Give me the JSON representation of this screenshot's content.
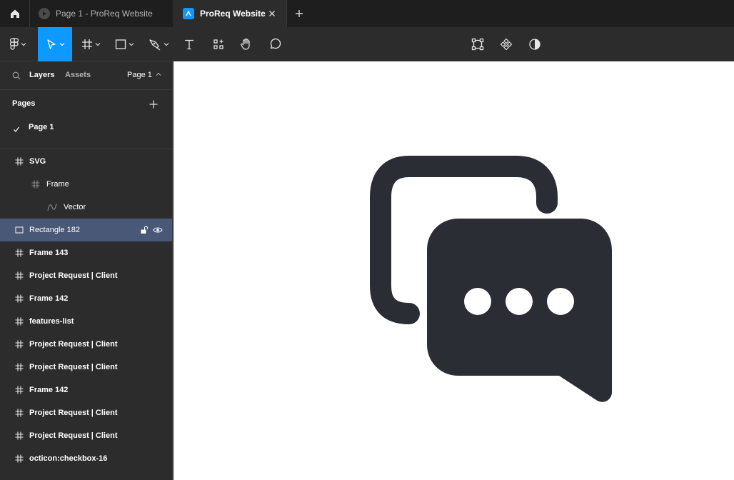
{
  "tabs": [
    {
      "label": "Page 1 - ProReq Website"
    },
    {
      "label": "ProReq Website"
    }
  ],
  "toolbar": {
    "tools": [
      "figma-menu",
      "move",
      "frame",
      "shape",
      "pen",
      "text",
      "resources",
      "hand",
      "comment"
    ],
    "right_tools": [
      "transform",
      "components",
      "contrast"
    ]
  },
  "sidebar": {
    "tab_layers": "Layers",
    "tab_assets": "Assets",
    "current_page": "Page 1",
    "pages_title": "Pages",
    "pages": [
      {
        "label": "Page 1",
        "selected": true
      }
    ],
    "layers": [
      {
        "label": "SVG",
        "icon": "frame-icon",
        "depth": 0,
        "bold": true
      },
      {
        "label": "Frame",
        "icon": "frame-icon",
        "depth": 1,
        "bold": false
      },
      {
        "label": "Vector",
        "icon": "vector-icon",
        "depth": 2,
        "bold": false
      },
      {
        "label": "Rectangle 182",
        "icon": "rectangle-icon",
        "depth": 0,
        "bold": false,
        "selected": true
      },
      {
        "label": "Frame 143",
        "icon": "frame-icon",
        "depth": 0,
        "bold": true
      },
      {
        "label": "Project Request | Client",
        "icon": "frame-icon",
        "depth": 0,
        "bold": true
      },
      {
        "label": "Frame 142",
        "icon": "frame-icon",
        "depth": 0,
        "bold": true
      },
      {
        "label": "features-list",
        "icon": "frame-icon",
        "depth": 0,
        "bold": true
      },
      {
        "label": "Project Request | Client",
        "icon": "frame-icon",
        "depth": 0,
        "bold": true
      },
      {
        "label": "Project Request | Client",
        "icon": "frame-icon",
        "depth": 0,
        "bold": true
      },
      {
        "label": "Frame 142",
        "icon": "frame-icon",
        "depth": 0,
        "bold": true
      },
      {
        "label": "Project Request | Client",
        "icon": "frame-icon",
        "depth": 0,
        "bold": true
      },
      {
        "label": "Project Request | Client",
        "icon": "frame-icon",
        "depth": 0,
        "bold": true
      },
      {
        "label": "octicon:checkbox-16",
        "icon": "frame-icon",
        "depth": 0,
        "bold": true
      }
    ]
  },
  "canvas": {
    "artwork": "chat-bubbles-icon",
    "artwork_color": "#2b2d35",
    "background": "#ffffff"
  },
  "colors": {
    "accent": "#0d99ff",
    "selection": "#4a5878",
    "panel": "#2c2c2c",
    "tabbar": "#1e1e1e"
  }
}
